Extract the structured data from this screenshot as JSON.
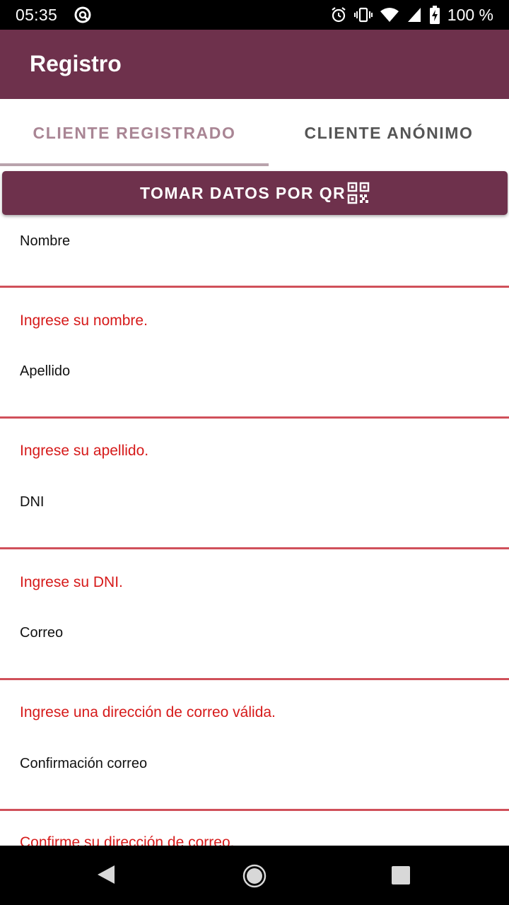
{
  "status_bar": {
    "time": "05:35",
    "battery_text": "100 %",
    "icons": [
      "blocked-icon",
      "alarm-icon",
      "vibrate-icon",
      "wifi-icon",
      "signal-icon",
      "battery-icon"
    ]
  },
  "app_bar": {
    "title": "Registro",
    "color": "#6e314c"
  },
  "tabs": [
    {
      "label": "CLIENTE REGISTRADO",
      "selected": true
    },
    {
      "label": "CLIENTE ANÓNIMO",
      "selected": false
    }
  ],
  "qr_button": {
    "label": "TOMAR DATOS POR QR",
    "icon": "qr-code-icon"
  },
  "form": {
    "fields": [
      {
        "label": "Nombre",
        "error": "Ingrese su nombre."
      },
      {
        "label": "Apellido",
        "error": "Ingrese su apellido."
      },
      {
        "label": "DNI",
        "error": "Ingrese su DNI."
      },
      {
        "label": "Correo",
        "error": "Ingrese una dirección de correo válida."
      },
      {
        "label": "Confirmación correo",
        "error": "Confirme su dirección de correo."
      }
    ],
    "error_color": "#d61a1a"
  },
  "nav_bar": {
    "icons": [
      "back-icon",
      "home-icon",
      "recents-icon"
    ]
  }
}
